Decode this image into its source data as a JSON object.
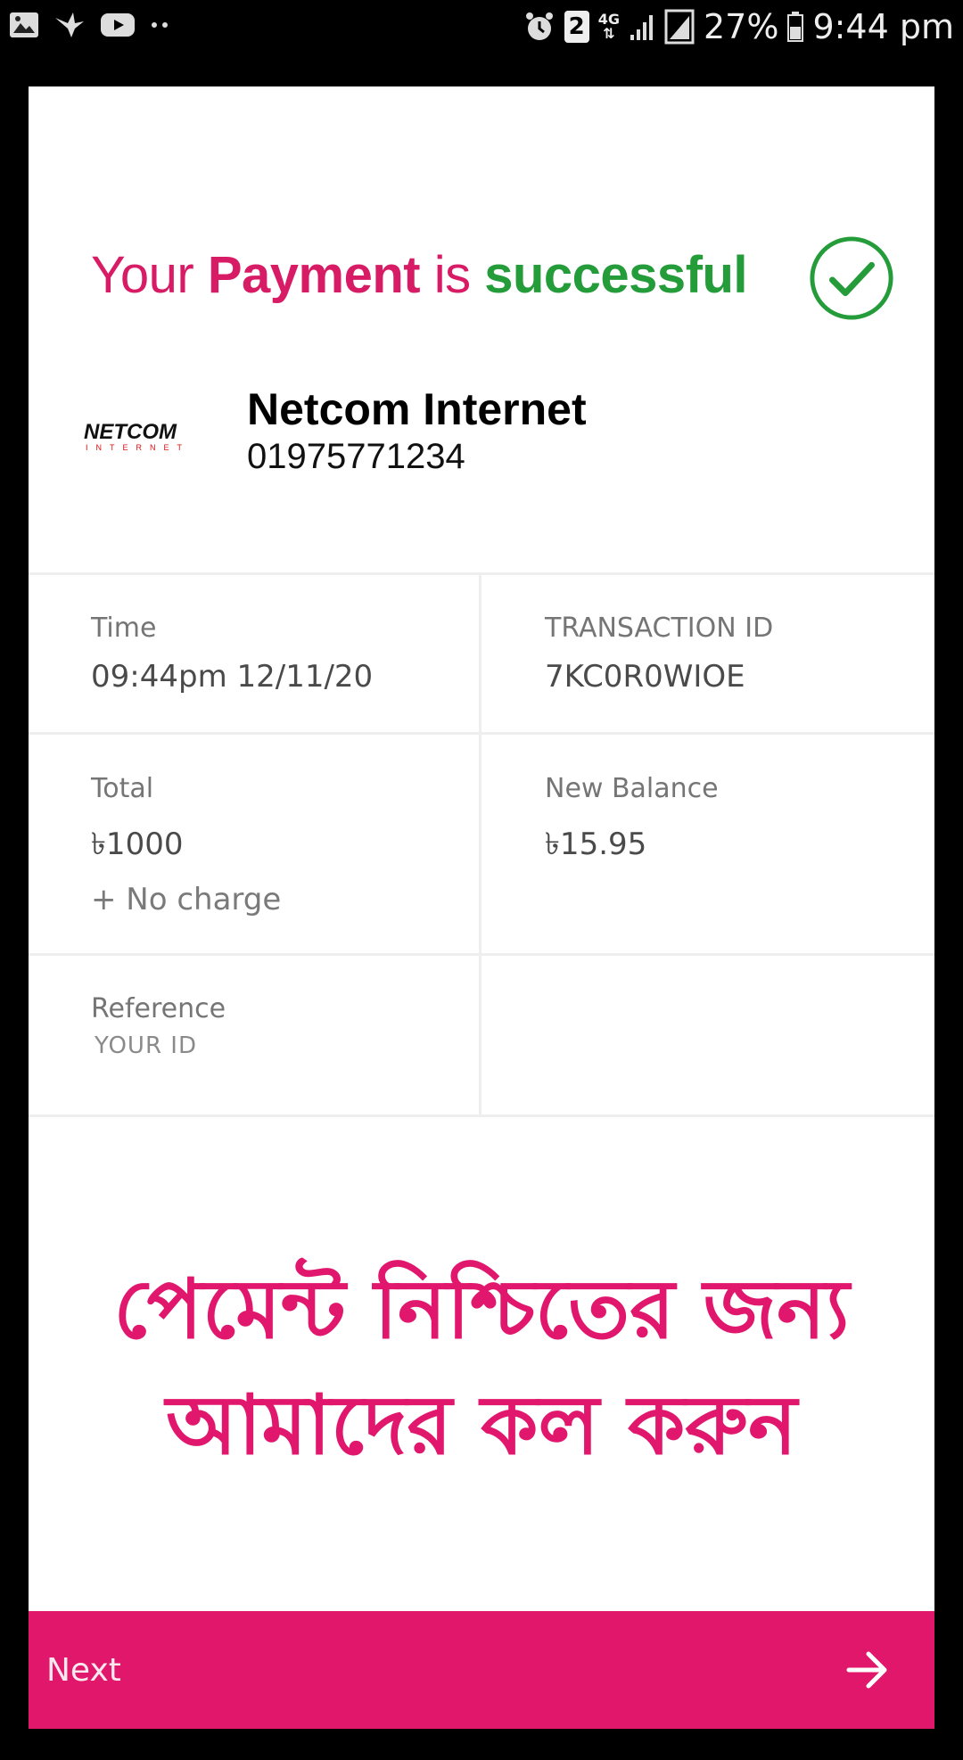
{
  "status_bar": {
    "icons_left": [
      "gallery-icon",
      "bird-icon",
      "youtube-icon",
      "more-dots-icon"
    ],
    "sim_badge": "2",
    "network_type": "4G",
    "battery_percent": "27%",
    "time": "9:44 pm"
  },
  "headline": {
    "part1": "Your ",
    "part2": "Payment",
    "part3": " is ",
    "part4": "successful",
    "icon": "success-check-icon"
  },
  "merchant": {
    "logo_text": "NETCOM",
    "logo_subtext": "INTERNET",
    "name": "Netcom Internet",
    "phone": "01975771234"
  },
  "details": {
    "time_label": "Time",
    "time_value": "09:44pm 12/11/20",
    "txn_label": "TRANSACTION ID",
    "txn_value": "7KC0R0WIOE",
    "total_label": "Total",
    "total_value": "৳1000",
    "charge_text": "+ No charge",
    "balance_label": "New Balance",
    "balance_value": "৳15.95",
    "reference_label": "Reference",
    "reference_value": "YOUR ID"
  },
  "notice": {
    "line1": "পেমেন্ট নিশ্চিতের জন্য",
    "line2": "আমাদের কল করুন"
  },
  "footer": {
    "next_label": "Next",
    "arrow_icon": "arrow-right-icon"
  },
  "colors": {
    "brand_pink": "#e0176a",
    "success_green": "#249c3a"
  }
}
